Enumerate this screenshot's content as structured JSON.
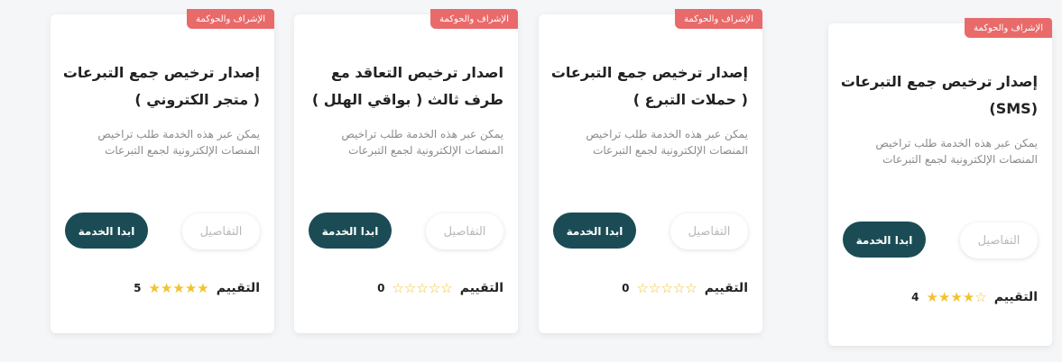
{
  "cards": [
    {
      "badge": "الإشراف والحوكمة",
      "title": "إصدار ترخيص جمع التبرعات ( متجر الكتروني )",
      "description": "يمكن عبر هذه الخدمة طلب تراخيص المنصات الإلكترونية لجمع التبرعات",
      "details_label": "التفاصيل",
      "start_label": "ابدا الخدمة",
      "rating_label": "التقييم",
      "rating": 5,
      "rating_count": "5"
    },
    {
      "badge": "الإشراف والحوكمة",
      "title": "اصدار ترخيص التعاقد مع طرف ثالث ( بواقي الهلل )",
      "description": "يمكن عبر هذه الخدمة طلب تراخيص المنصات الإلكترونية لجمع التبرعات",
      "details_label": "التفاصيل",
      "start_label": "ابدا الخدمة",
      "rating_label": "التقييم",
      "rating": 0,
      "rating_count": "0"
    },
    {
      "badge": "الإشراف والحوكمة",
      "title": "إصدار ترخيص جمع التبرعات ( حملات التبرع )",
      "description": "يمكن عبر هذه الخدمة طلب تراخيص المنصات الإلكترونية لجمع التبرعات",
      "details_label": "التفاصيل",
      "start_label": "ابدا الخدمة",
      "rating_label": "التقييم",
      "rating": 0,
      "rating_count": "0"
    },
    {
      "badge": "الإشراف والحوكمة",
      "title": "إصدار ترخيص جمع التبرعات (SMS)",
      "description": "يمكن عبر هذه الخدمة طلب تراخيص المنصات الإلكترونية لجمع التبرعات",
      "details_label": "التفاصيل",
      "start_label": "ابدا الخدمة",
      "rating_label": "التقييم",
      "rating": 4,
      "rating_count": "4"
    }
  ],
  "colors": {
    "badge": "#e96a6a",
    "primary_button": "#1b4c55",
    "star": "#f2c230"
  }
}
